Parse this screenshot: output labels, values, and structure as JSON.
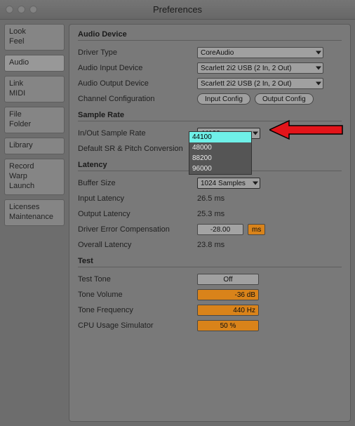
{
  "window": {
    "title": "Preferences"
  },
  "sidebar": {
    "groups": [
      {
        "items": [
          "Look",
          "Feel"
        ]
      },
      {
        "items": [
          "Audio"
        ],
        "active": true
      },
      {
        "items": [
          "Link",
          "MIDI"
        ]
      },
      {
        "items": [
          "File",
          "Folder"
        ]
      },
      {
        "items": [
          "Library"
        ]
      },
      {
        "items": [
          "Record",
          "Warp",
          "Launch"
        ]
      },
      {
        "items": [
          "Licenses",
          "Maintenance"
        ]
      }
    ]
  },
  "sections": {
    "audio_device": {
      "title": "Audio Device",
      "driver_type_label": "Driver Type",
      "driver_type_value": "CoreAudio",
      "input_label": "Audio Input Device",
      "input_value": "Scarlett 2i2 USB (2 In, 2 Out)",
      "output_label": "Audio Output Device",
      "output_value": "Scarlett 2i2 USB (2 In, 2 Out)",
      "channel_label": "Channel Configuration",
      "input_config_btn": "Input Config",
      "output_config_btn": "Output Config"
    },
    "sample_rate": {
      "title": "Sample Rate",
      "inout_label": "In/Out Sample Rate",
      "inout_value": "44100",
      "options": [
        "44100",
        "48000",
        "88200",
        "96000"
      ],
      "default_label": "Default SR & Pitch Conversion"
    },
    "latency": {
      "title": "Latency",
      "buffer_label": "Buffer Size",
      "buffer_value": "1024 Samples",
      "input_lat_label": "Input Latency",
      "input_lat_value": "26.5 ms",
      "output_lat_label": "Output Latency",
      "output_lat_value": "25.3 ms",
      "error_comp_label": "Driver Error Compensation",
      "error_comp_value": "-28.00",
      "error_comp_unit": "ms",
      "overall_label": "Overall Latency",
      "overall_value": "23.8 ms"
    },
    "test": {
      "title": "Test",
      "tone_label": "Test Tone",
      "tone_value": "Off",
      "volume_label": "Tone Volume",
      "volume_value": "-36",
      "volume_unit": "dB",
      "freq_label": "Tone Frequency",
      "freq_value": "440",
      "freq_unit": "Hz",
      "cpu_label": "CPU Usage Simulator",
      "cpu_value": "50",
      "cpu_unit": "%"
    }
  },
  "annotation": {
    "arrow_color": "#e3141a"
  }
}
